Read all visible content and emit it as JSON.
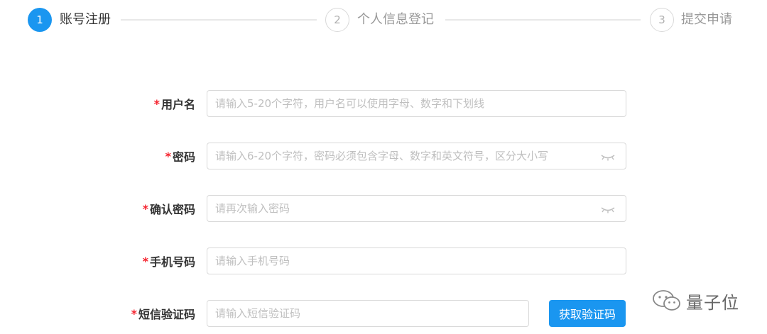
{
  "steps": [
    {
      "number": "1",
      "label": "账号注册",
      "state": "active"
    },
    {
      "number": "2",
      "label": "个人信息登记",
      "state": "inactive"
    },
    {
      "number": "3",
      "label": "提交申请",
      "state": "inactive"
    }
  ],
  "form": {
    "required_mark": "*",
    "username": {
      "label": "用户名",
      "placeholder": "请输入5-20个字符，用户名可以使用字母、数字和下划线"
    },
    "password": {
      "label": "密码",
      "placeholder": "请输入6-20个字符，密码必须包含字母、数字和英文符号，区分大小写"
    },
    "confirm_password": {
      "label": "确认密码",
      "placeholder": "请再次输入密码"
    },
    "phone": {
      "label": "手机号码",
      "placeholder": "请输入手机号码"
    },
    "sms_code": {
      "label": "短信验证码",
      "placeholder": "请输入短信验证码",
      "button_label": "获取验证码"
    }
  },
  "watermark": {
    "icon": "wechat-icon",
    "text": "量子位"
  },
  "colors": {
    "accent": "#1a96f0",
    "required": "#f5222d",
    "border": "#d9d9d9",
    "placeholder": "#bfbfbf"
  }
}
